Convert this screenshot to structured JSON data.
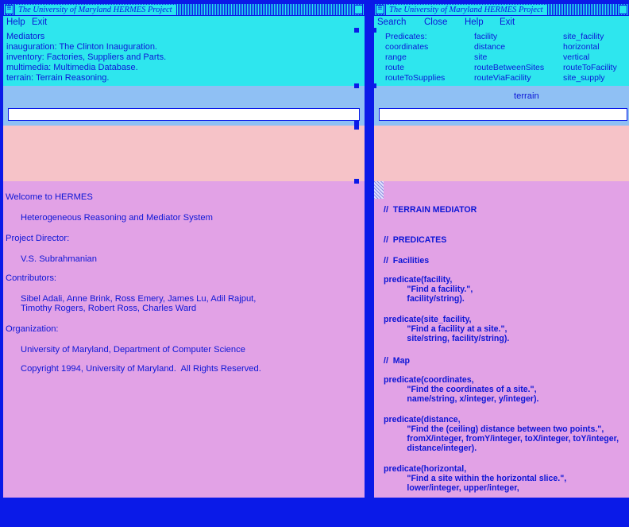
{
  "left_window": {
    "title": "The University of Maryland HERMES Project",
    "menu": [
      "Help",
      "Exit"
    ],
    "mediators": [
      "Mediators",
      "inauguration: The Clinton Inauguration.",
      "inventory: Factories, Suppliers and Parts.",
      "multimedia: Multimedia Database.",
      "terrain: Terrain Reasoning."
    ],
    "input_value": "",
    "content": [
      "Welcome to HERMES",
      "Heterogeneous Reasoning and Mediator System",
      "Project Director:",
      "V.S. Subrahmanian",
      "Contributors:",
      "Sibel Adali, Anne Brink, Ross Emery, James Lu, Adil Rajput,",
      "Timothy Rogers, Robert Ross, Charles Ward",
      "Organization:",
      "University of Maryland, Department of Computer Science",
      "Copyright 1994, University of Maryland.  All Rights Reserved."
    ]
  },
  "right_window": {
    "title": "The University of Maryland HERMES Project",
    "menu": [
      "Search",
      "Close",
      "Help",
      "Exit"
    ],
    "predicates": [
      [
        "Predicates:",
        "facility",
        "site_facility"
      ],
      [
        "coordinates",
        "distance",
        "horizontal"
      ],
      [
        "range",
        "site",
        "vertical"
      ],
      [
        "route",
        "routeBetweenSites",
        "routeToFacility"
      ],
      [
        "routeToSupplies",
        "routeViaFacility",
        "site_supply"
      ]
    ],
    "selected_mediator": "terrain",
    "input_value": "",
    "code_lines": [
      "//  TERRAIN MEDIATOR",
      "//  PREDICATES",
      "//  Facilities",
      "predicate(facility,",
      "          \"Find a facility.\",",
      "          facility/string).",
      "predicate(site_facility,",
      "          \"Find a facility at a site.\",",
      "          site/string, facility/string).",
      "//  Map",
      "predicate(coordinates,",
      "          \"Find the coordinates of a site.\",",
      "          name/string, x/integer, y/integer).",
      "predicate(distance,",
      "          \"Find the (ceiling) distance between two points.\",",
      "          fromX/integer, fromY/integer, toX/integer, toY/integer,",
      "          distance/integer).",
      "predicate(horizontal,",
      "          \"Find a site within the horizontal slice.\",",
      "          lower/integer, upper/integer,"
    ]
  }
}
